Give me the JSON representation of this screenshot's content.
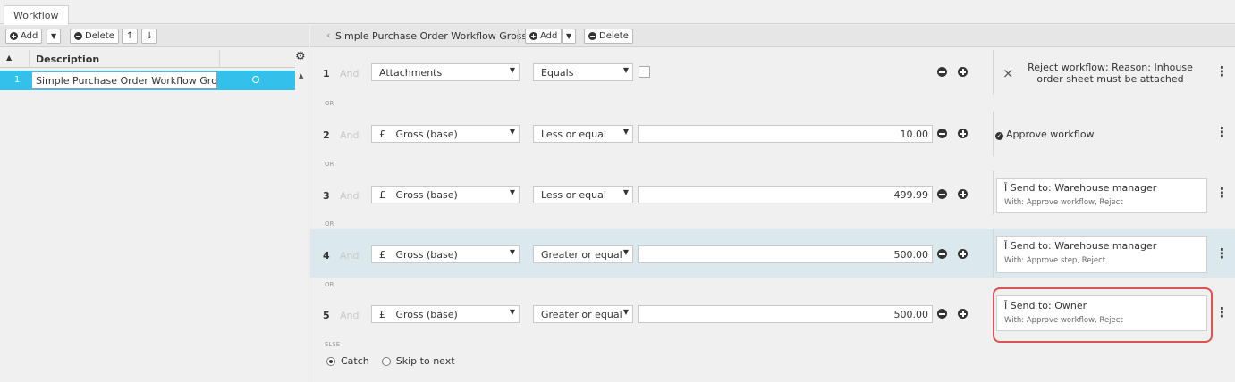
{
  "tabs": [
    {
      "label": "Workflow"
    }
  ],
  "left_toolbar": {
    "add_label": "Add",
    "dropdown_arrow": "▼",
    "delete_label": "Delete",
    "up_arrow": "↑",
    "down_arrow": "↓"
  },
  "workflow_grid": {
    "column_description": "Description",
    "rows": [
      {
        "num": "1",
        "description": "Simple Purchase Order Workflow Gross"
      }
    ]
  },
  "right_toolbar": {
    "title": "Simple Purchase Order Workflow Gross",
    "add_label": "Add",
    "dropdown_arrow": "▼",
    "delete_label": "Delete"
  },
  "rules": [
    {
      "num": "1",
      "and": "And",
      "field": "Attachments",
      "has_pound": false,
      "operator": "Equals",
      "value_type": "checkbox",
      "value": "",
      "action_type": "reject",
      "action": "Reject workflow; Reason: Inhouse order sheet must be attached",
      "sub": ""
    },
    {
      "num": "2",
      "and": "And",
      "field": "Gross (base)",
      "has_pound": true,
      "operator": "Less or equal",
      "value_type": "number",
      "value": "10.00",
      "action_type": "approve",
      "action": "Approve workflow",
      "sub": ""
    },
    {
      "num": "3",
      "and": "And",
      "field": "Gross (base)",
      "has_pound": true,
      "operator": "Less or equal",
      "value_type": "number",
      "value": "499.99",
      "action_type": "send",
      "action": "Send to: Warehouse manager",
      "sub": "With:  Approve workflow, Reject"
    },
    {
      "num": "4",
      "and": "And",
      "field": "Gross (base)",
      "has_pound": true,
      "operator": "Greater or equal",
      "value_type": "number",
      "value": "500.00",
      "action_type": "send",
      "action": "Send to: Warehouse manager",
      "sub": "With:  Approve step, Reject"
    },
    {
      "num": "5",
      "and": "And",
      "field": "Gross (base)",
      "has_pound": true,
      "operator": "Greater or equal",
      "value_type": "number",
      "value": "500.00",
      "action_type": "send",
      "action": "Send to: Owner",
      "sub": "With:  Approve workflow, Reject"
    }
  ],
  "or_label": "OR",
  "pound": "£",
  "else_label": "ELSE",
  "else_options": [
    {
      "label": "Catch",
      "selected": true
    },
    {
      "label": "Skip to next",
      "selected": false
    }
  ],
  "highlight_color": "#d9534f",
  "selection_color": "#33c0ea"
}
